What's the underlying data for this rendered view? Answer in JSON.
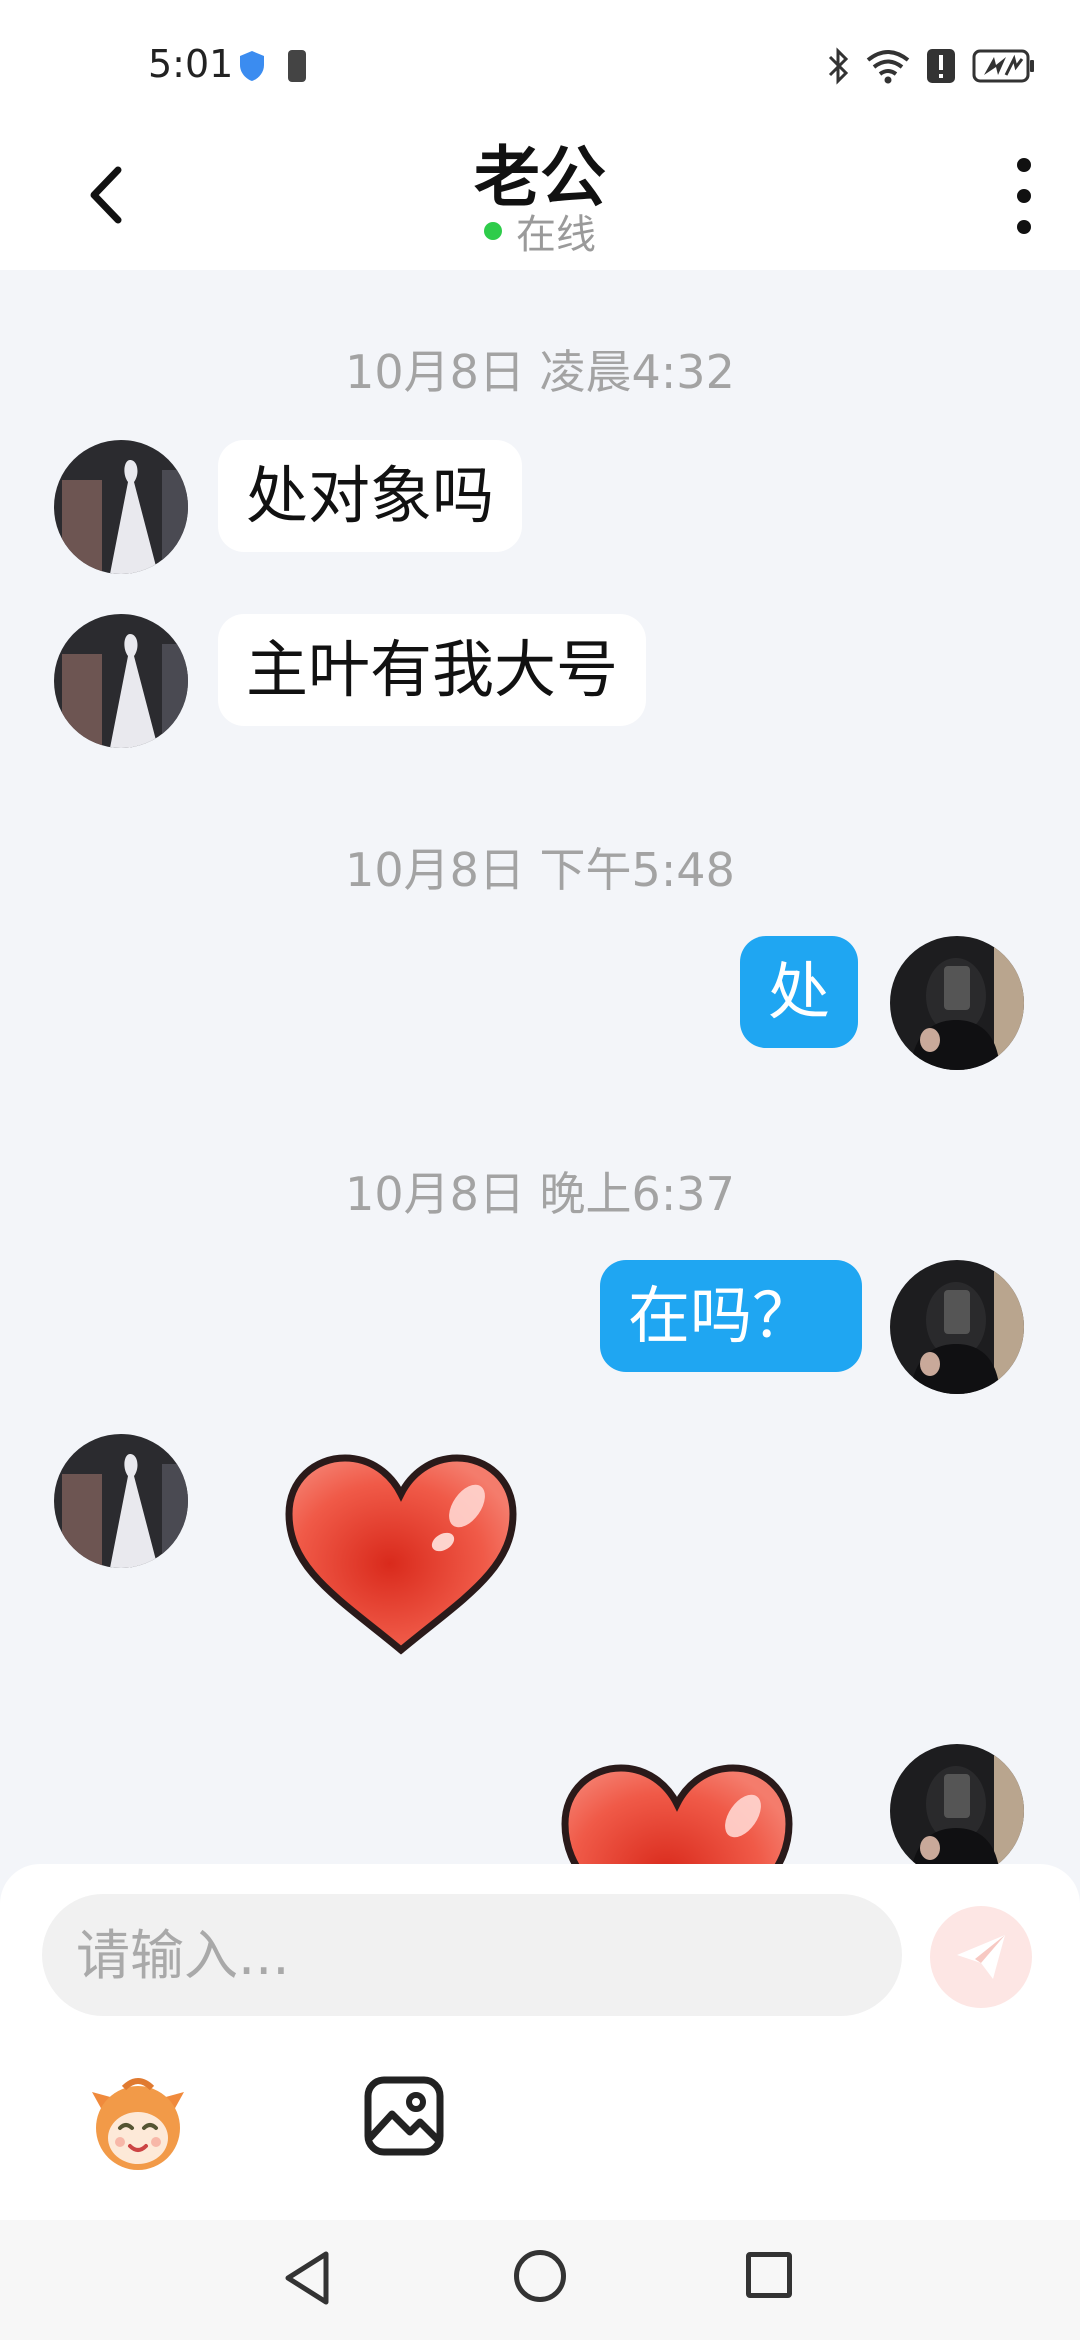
{
  "status_bar": {
    "time": "5:01"
  },
  "header": {
    "title": "老公",
    "status": "在线"
  },
  "messages": [
    {
      "type": "timestamp",
      "text": "10月8日 凌晨4:32"
    },
    {
      "type": "text",
      "side": "in",
      "text": "处对象吗"
    },
    {
      "type": "text",
      "side": "in",
      "text": "主叶有我大号"
    },
    {
      "type": "timestamp",
      "text": "10月8日 下午5:48"
    },
    {
      "type": "text",
      "side": "out",
      "text": "处"
    },
    {
      "type": "timestamp",
      "text": "10月8日 晚上6:37"
    },
    {
      "type": "text",
      "side": "out",
      "text": "在吗？"
    },
    {
      "type": "sticker",
      "side": "in",
      "icon": "heart-sticker"
    },
    {
      "type": "sticker",
      "side": "out",
      "icon": "heart-sticker"
    }
  ],
  "input": {
    "placeholder": "请输入..."
  },
  "colors": {
    "accent": "#1fa6f2",
    "online": "#2ecc4a",
    "send_disabled": "#fde6e4",
    "chat_bg": "#f3f5f9"
  }
}
